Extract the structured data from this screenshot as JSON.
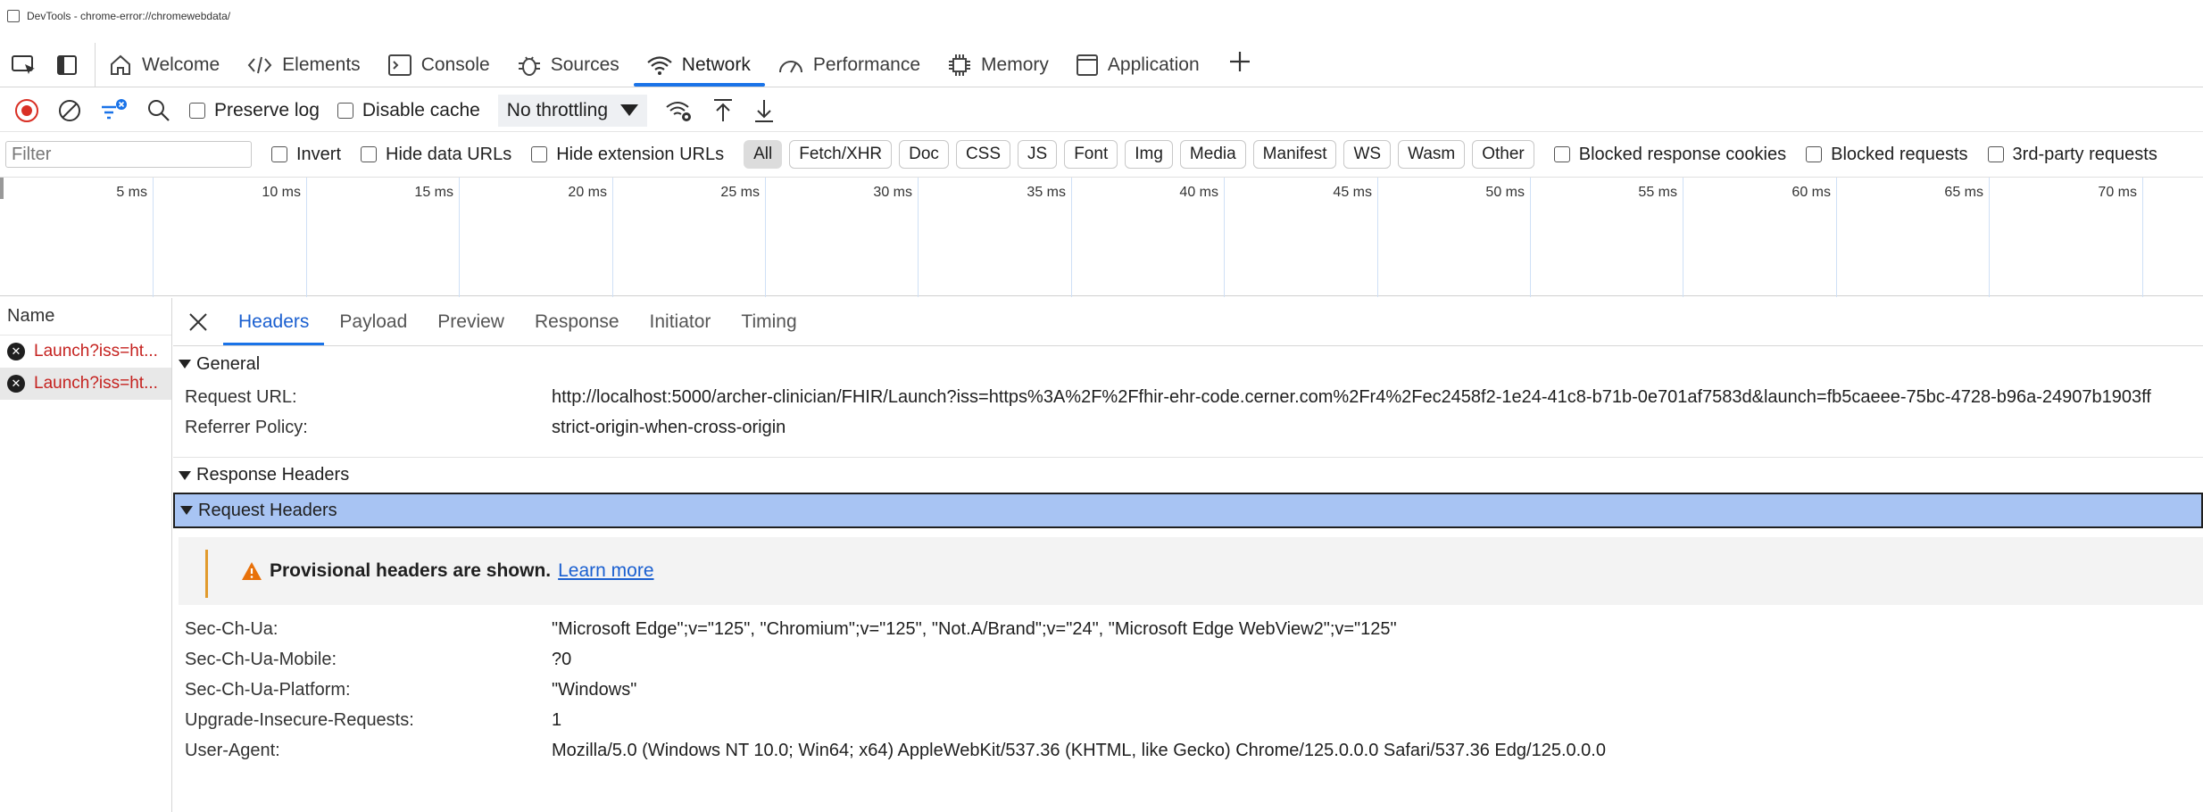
{
  "window": {
    "title": "DevTools - chrome-error://chromewebdata/"
  },
  "main_tabs": [
    {
      "label": "Welcome",
      "icon": "home-icon"
    },
    {
      "label": "Elements",
      "icon": "code-icon"
    },
    {
      "label": "Console",
      "icon": "console-icon"
    },
    {
      "label": "Sources",
      "icon": "bug-icon"
    },
    {
      "label": "Network",
      "icon": "wifi-icon",
      "active": true
    },
    {
      "label": "Performance",
      "icon": "performance-icon"
    },
    {
      "label": "Memory",
      "icon": "memory-chip-icon"
    },
    {
      "label": "Application",
      "icon": "application-icon"
    }
  ],
  "toolbar": {
    "preserve_log": "Preserve log",
    "disable_cache": "Disable cache",
    "throttling": "No throttling"
  },
  "filter": {
    "placeholder": "Filter",
    "invert": "Invert",
    "hide_data_urls": "Hide data URLs",
    "hide_extension_urls": "Hide extension URLs",
    "types": [
      "All",
      "Fetch/XHR",
      "Doc",
      "CSS",
      "JS",
      "Font",
      "Img",
      "Media",
      "Manifest",
      "WS",
      "Wasm",
      "Other"
    ],
    "blocked_response_cookies": "Blocked response cookies",
    "blocked_requests": "Blocked requests",
    "third_party": "3rd-party requests"
  },
  "timeline": {
    "ticks": [
      "5 ms",
      "10 ms",
      "15 ms",
      "20 ms",
      "25 ms",
      "30 ms",
      "35 ms",
      "40 ms",
      "45 ms",
      "50 ms",
      "55 ms",
      "60 ms",
      "65 ms",
      "70 ms"
    ]
  },
  "requests": {
    "header": "Name",
    "rows": [
      {
        "name": "Launch?iss=ht..."
      },
      {
        "name": "Launch?iss=ht..."
      }
    ]
  },
  "detail_tabs": [
    "Headers",
    "Payload",
    "Preview",
    "Response",
    "Initiator",
    "Timing"
  ],
  "general": {
    "title": "General",
    "request_url_label": "Request URL:",
    "request_url": "http://localhost:5000/archer-clinician/FHIR/Launch?iss=https%3A%2F%2Ffhir-ehr-code.cerner.com%2Fr4%2Fec2458f2-1e24-41c8-b71b-0e701af7583d&launch=fb5caeee-75bc-4728-b96a-24907b1903ff",
    "referrer_label": "Referrer Policy:",
    "referrer": "strict-origin-when-cross-origin"
  },
  "response_headers": {
    "title": "Response Headers"
  },
  "request_headers": {
    "title": "Request Headers",
    "warning_bold": "Provisional headers are shown.",
    "learn_more": "Learn more",
    "rows": [
      {
        "k": "Sec-Ch-Ua:",
        "v": "\"Microsoft Edge\";v=\"125\", \"Chromium\";v=\"125\", \"Not.A/Brand\";v=\"24\", \"Microsoft Edge WebView2\";v=\"125\""
      },
      {
        "k": "Sec-Ch-Ua-Mobile:",
        "v": "?0"
      },
      {
        "k": "Sec-Ch-Ua-Platform:",
        "v": "\"Windows\""
      },
      {
        "k": "Upgrade-Insecure-Requests:",
        "v": "1"
      },
      {
        "k": "User-Agent:",
        "v": "Mozilla/5.0 (Windows NT 10.0; Win64; x64) AppleWebKit/537.36 (KHTML, like Gecko) Chrome/125.0.0.0 Safari/537.36 Edg/125.0.0.0"
      }
    ]
  }
}
